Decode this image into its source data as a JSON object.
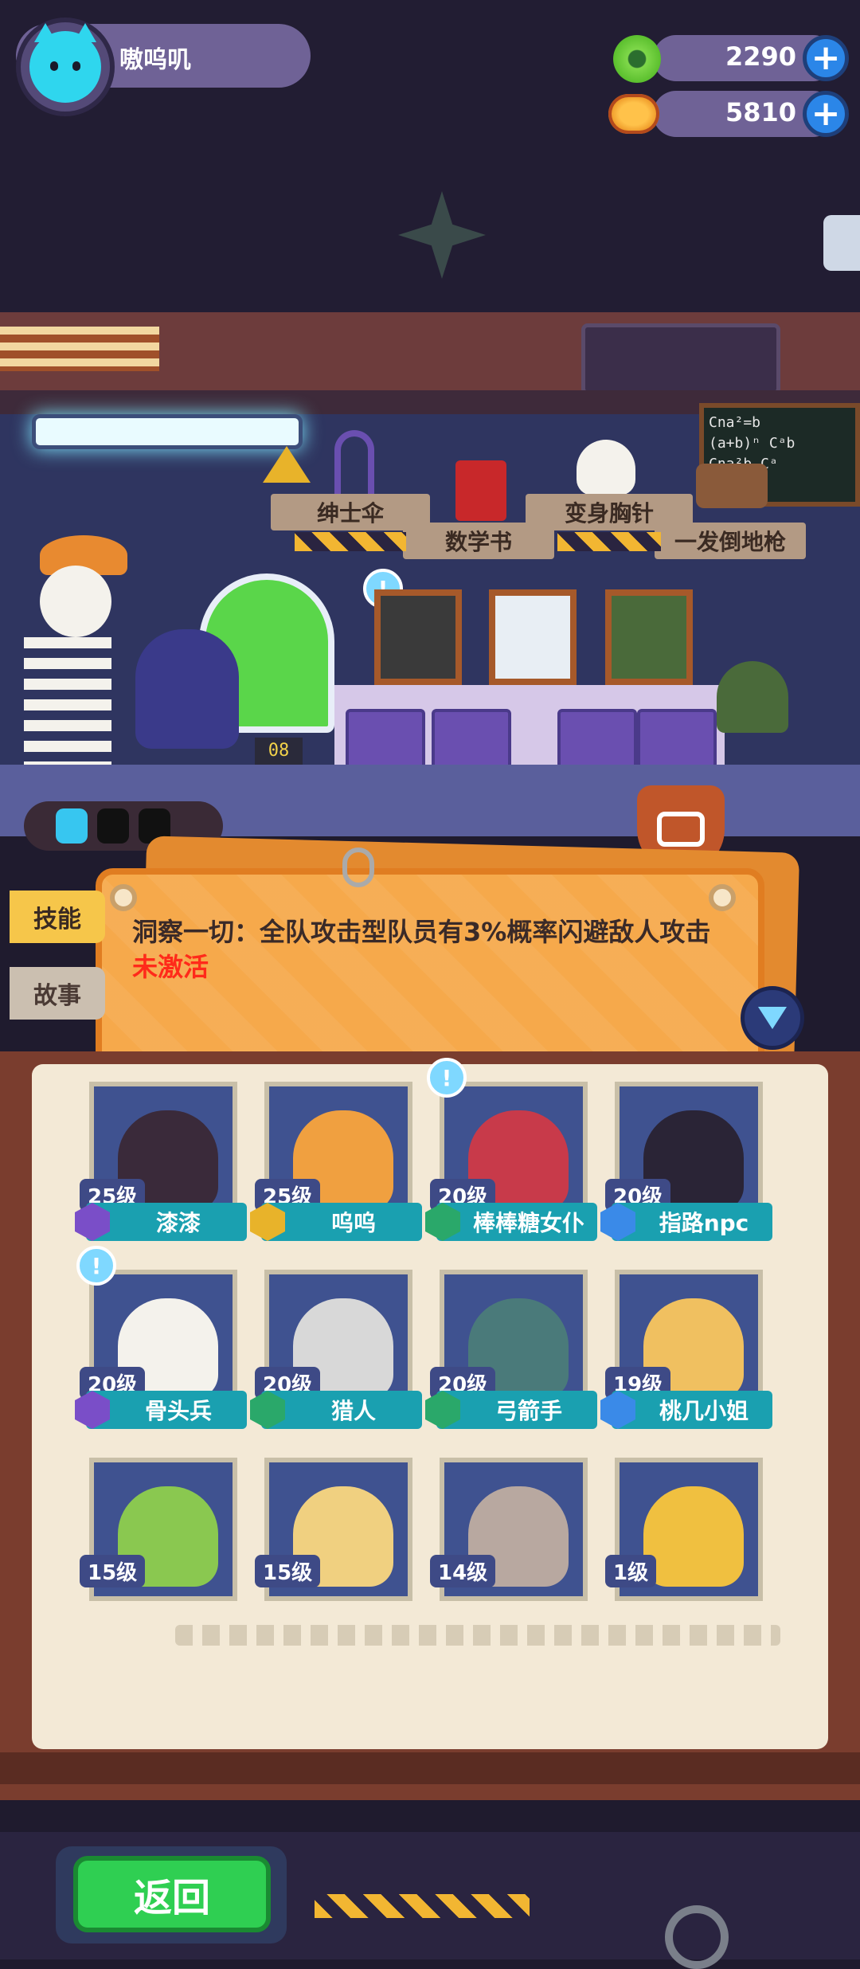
{
  "header": {
    "player_name": "嗷呜叽",
    "currencies": [
      {
        "name": "green-coin",
        "value": "2290",
        "color": "#5bbf2e"
      },
      {
        "name": "orange-coin",
        "value": "5810",
        "color": "#ffc24a"
      }
    ]
  },
  "room": {
    "item_labels": [
      "绅士伞",
      "数学书",
      "变身胸针",
      "一发倒地枪"
    ],
    "chalkboard": [
      "Cna²=b",
      "(a+b)ⁿ  Cᵃb",
      "Cna²b  Cᵃ"
    ],
    "tank_counter": "08",
    "energy": {
      "filled": 1,
      "total": 3
    }
  },
  "tabs": {
    "skill": "技能",
    "story": "故事"
  },
  "skill_panel": {
    "text": "洞察一切：全队攻击型队员有3%概率闪避敌人攻击",
    "status": "未激活",
    "status_color": "#ff2a1a"
  },
  "characters": [
    {
      "level": "25级",
      "name": "漆漆",
      "badge_color": "#7a4ec8",
      "bubble": false
    },
    {
      "level": "25级",
      "name": "呜呜",
      "badge_color": "#e8b32a",
      "bubble": false
    },
    {
      "level": "20级",
      "name": "棒棒糖女仆",
      "badge_color": "#2aa86a",
      "bubble": true
    },
    {
      "level": "20级",
      "name": "指路npc",
      "badge_color": "#3a8ae8",
      "bubble": false
    },
    {
      "level": "20级",
      "name": "骨头兵",
      "badge_color": "#7a4ec8",
      "bubble": true
    },
    {
      "level": "20级",
      "name": "猎人",
      "badge_color": "#2aa86a",
      "bubble": false
    },
    {
      "level": "20级",
      "name": "弓箭手",
      "badge_color": "#2aa86a",
      "bubble": false
    },
    {
      "level": "19级",
      "name": "桃几小姐",
      "badge_color": "#3a8ae8",
      "bubble": false
    },
    {
      "level": "15级",
      "name": "",
      "badge_color": "",
      "bubble": false
    },
    {
      "level": "15级",
      "name": "",
      "badge_color": "",
      "bubble": false
    },
    {
      "level": "14级",
      "name": "",
      "badge_color": "",
      "bubble": false
    },
    {
      "level": "1级",
      "name": "",
      "badge_color": "",
      "bubble": false
    }
  ],
  "footer": {
    "back_label": "返回"
  }
}
